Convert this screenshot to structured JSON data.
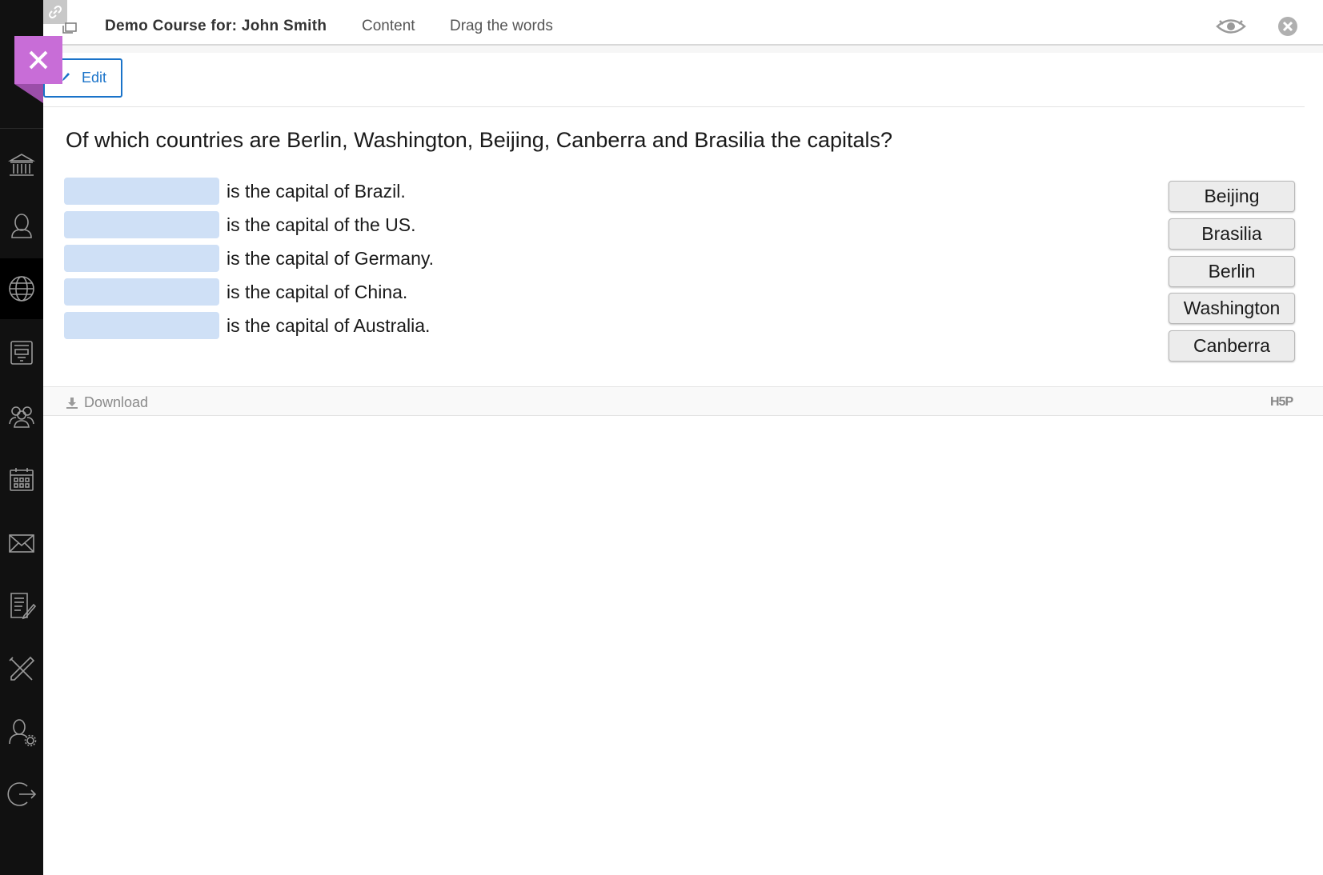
{
  "header": {
    "course_title": "Demo Course for: John Smith",
    "breadcrumb_content": "Content",
    "breadcrumb_activity": "Drag the words"
  },
  "toolbar": {
    "edit_label": "Edit"
  },
  "sidebar": {
    "items": [
      {
        "icon": "institution-icon"
      },
      {
        "icon": "profile-icon"
      },
      {
        "icon": "globe-icon",
        "active": true
      },
      {
        "icon": "content-icon"
      },
      {
        "icon": "groups-icon"
      },
      {
        "icon": "calendar-icon"
      },
      {
        "icon": "messages-icon"
      },
      {
        "icon": "grades-icon"
      },
      {
        "icon": "tools-icon"
      },
      {
        "icon": "admin-icon"
      },
      {
        "icon": "sign-out-icon"
      }
    ]
  },
  "activity": {
    "question": "Of which countries are Berlin, Washington, Beijing, Canberra and Brasilia the capitals?",
    "rows": [
      {
        "text": "is the capital of Brazil."
      },
      {
        "text": "is the capital of the US."
      },
      {
        "text": "is the capital of Germany."
      },
      {
        "text": "is the capital of China."
      },
      {
        "text": "is the capital of Australia."
      }
    ],
    "words": [
      "Beijing",
      "Brasilia",
      "Berlin",
      "Washington",
      "Canberra"
    ]
  },
  "footer": {
    "download_label": "Download",
    "logo_text": "H5P"
  },
  "colors": {
    "accent": "#1a73c9",
    "close_tab": "#c86dd7",
    "drop_zone": "#cfe0f6",
    "sidebar": "#111111"
  }
}
